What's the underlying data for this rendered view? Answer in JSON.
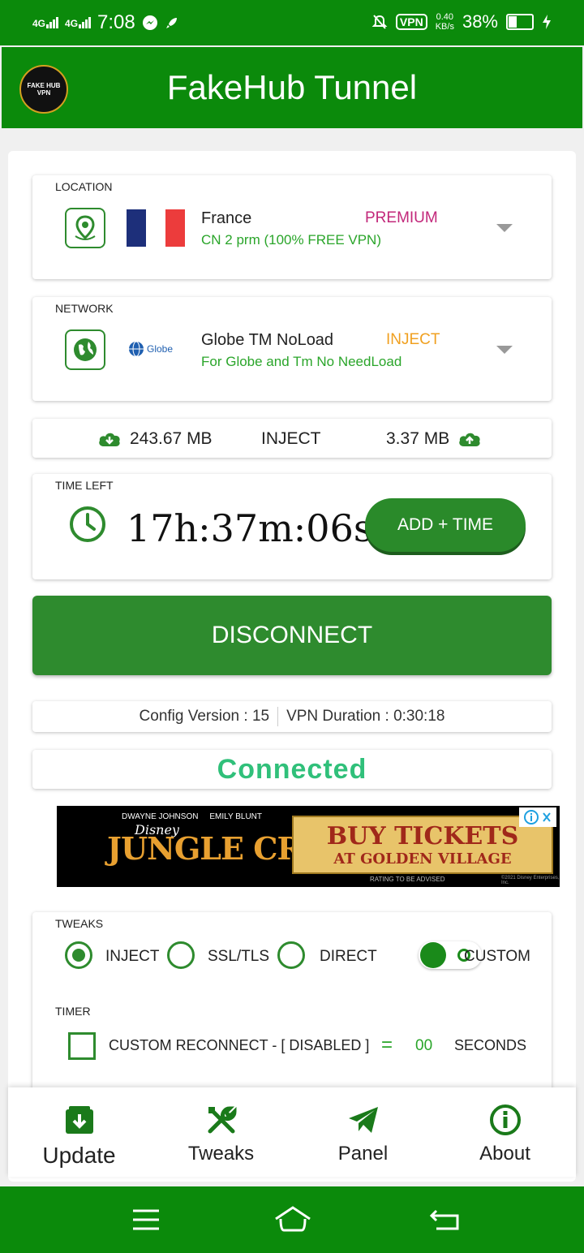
{
  "status_bar": {
    "network1": "4G",
    "network2": "4G",
    "time": "7:08",
    "vpn": "VPN",
    "speed_value": "0.40",
    "speed_unit": "KB/s",
    "battery": "38%",
    "battery_level": 0.38
  },
  "app": {
    "title": "FakeHub Tunnel",
    "logo_text": "FAKE HUB",
    "logo_sub": "VPN"
  },
  "location": {
    "caption": "LOCATION",
    "name": "France",
    "tier": "PREMIUM",
    "detail": "CN 2 prm (100% FREE VPN)"
  },
  "network": {
    "caption": "NETWORK",
    "logo_text": "Globe",
    "name": "Globe TM NoLoad",
    "mode": "INJECT",
    "detail": "For Globe and Tm No NeedLoad"
  },
  "stats": {
    "download": "243.67 MB",
    "mode": "INJECT",
    "upload": "3.37 MB"
  },
  "timer": {
    "caption": "TIME LEFT",
    "value": "17h:37m:06s",
    "add_button": "ADD + TIME"
  },
  "disconnect_button": "DISCONNECT",
  "info": {
    "config_version": "Config Version : 15",
    "vpn_duration": "VPN Duration : 0:30:18"
  },
  "status": "Connected",
  "ad": {
    "actor1": "DWAYNE JOHNSON",
    "actor2": "EMILY BLUNT",
    "brand": "Disney",
    "movie": "JUNGLE CRUISE",
    "buy_line1": "BUY TICKETS",
    "buy_line2": "AT GOLDEN VILLAGE",
    "rating": "RATING TO BE ADVISED",
    "copyright": "©2021 Disney Enterprises, Inc."
  },
  "tweaks": {
    "caption": "TWEAKS",
    "options": [
      {
        "label": "INJECT",
        "selected": true
      },
      {
        "label": "SSL/TLS",
        "selected": false
      },
      {
        "label": "DIRECT",
        "selected": false
      }
    ],
    "custom_label": "CUSTOM",
    "custom_on": false
  },
  "reconnect": {
    "caption": "TIMER",
    "label": "CUSTOM RECONNECT - [ DISABLED ]",
    "equals": "=",
    "value": "00",
    "unit": "SECONDS"
  },
  "bottom_nav": [
    {
      "label": "Update",
      "icon": "update-icon"
    },
    {
      "label": "Tweaks",
      "icon": "tools-icon"
    },
    {
      "label": "Panel",
      "icon": "telegram-icon"
    },
    {
      "label": "About",
      "icon": "info-icon"
    }
  ],
  "colors": {
    "primary": "#0b8a0b",
    "button": "#2e8b2e",
    "premium": "#c2277a",
    "inject": "#f0a020",
    "connected": "#30c07a"
  }
}
